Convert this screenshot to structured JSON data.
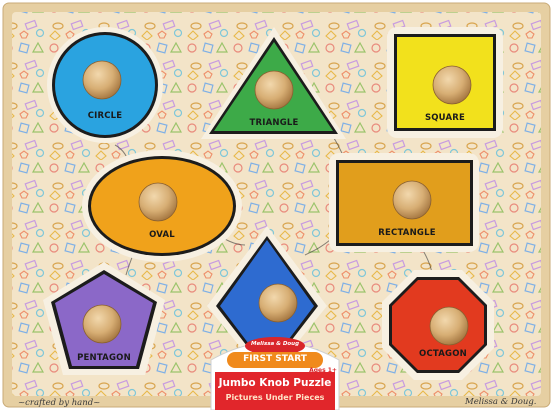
{
  "shapes": [
    {
      "name": "circle",
      "label": "CIRCLE",
      "color": "#2aa3e0"
    },
    {
      "name": "triangle",
      "label": "TRIANGLE",
      "color": "#3daa48"
    },
    {
      "name": "square",
      "label": "SQUARE",
      "color": "#f2e11c"
    },
    {
      "name": "oval",
      "label": "OVAL",
      "color": "#f0a21b"
    },
    {
      "name": "rectangle",
      "label": "RECTANGLE",
      "color": "#e19e1c"
    },
    {
      "name": "diamond",
      "label": "",
      "color": "#2e6bd0"
    },
    {
      "name": "pentagon",
      "label": "PENTAGON",
      "color": "#8b68c8"
    },
    {
      "name": "octagon",
      "label": "OCTAGON",
      "color": "#e23a1f"
    }
  ],
  "footer": {
    "left": "~crafted by hand~",
    "right": "Melissa & Doug."
  },
  "badge": {
    "brand": "Melissa & Doug",
    "series": "FIRST START",
    "age": "Ages 1+",
    "title": "Jumbo Knob Puzzle",
    "subtitle": "Pictures Under Pieces"
  },
  "colors": {
    "wood": "#f3e3c4",
    "frame": "#e9d3a8",
    "knob": "#d9b27c"
  }
}
